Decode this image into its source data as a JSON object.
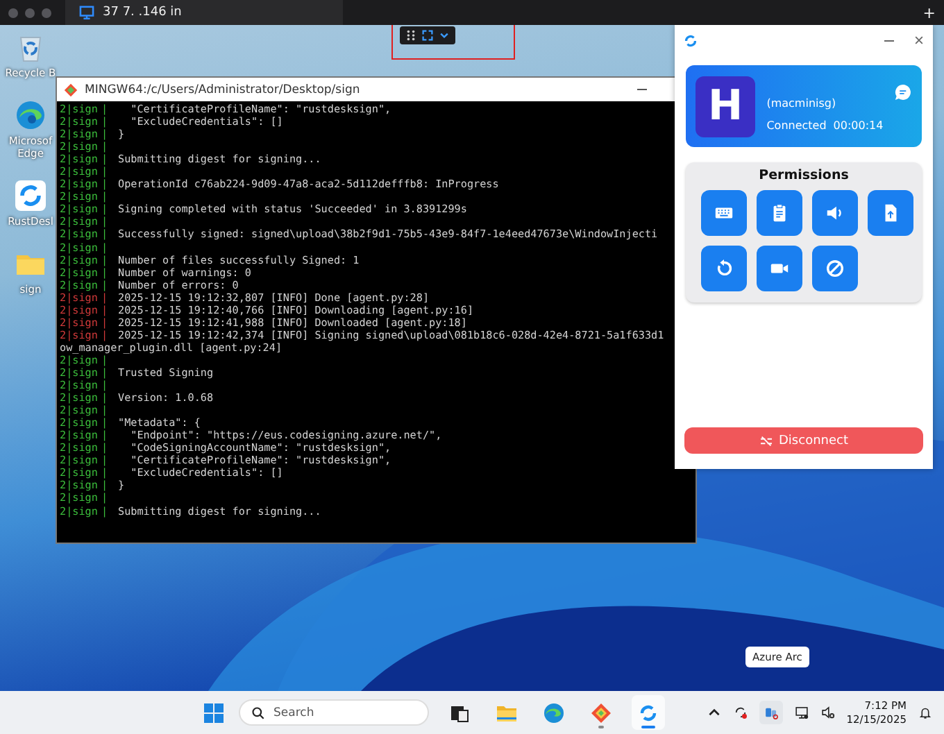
{
  "top_bar": {
    "tab_title": "37 7. .146 in",
    "new_tab": "+"
  },
  "desktop_icons": [
    {
      "kind": "recycle",
      "label": "Recycle B"
    },
    {
      "kind": "edge",
      "label": "Microsof Edge"
    },
    {
      "kind": "rustdesk",
      "label": "RustDesl"
    },
    {
      "kind": "folder",
      "label": "sign"
    }
  ],
  "terminal": {
    "title": "MINGW64:/c/Users/Administrator/Desktop/sign",
    "lines": [
      {
        "kind": "log",
        "prefix": "2|sign",
        "sep": "|",
        "text": "  \"CertificateProfileName\": \"rustdesksign\","
      },
      {
        "kind": "log",
        "prefix": "2|sign",
        "sep": "|",
        "text": "  \"ExcludeCredentials\": []"
      },
      {
        "kind": "log",
        "prefix": "2|sign",
        "sep": "|",
        "text": "}"
      },
      {
        "kind": "log",
        "prefix": "2|sign",
        "sep": "|"
      },
      {
        "kind": "log",
        "prefix": "2|sign",
        "sep": "|",
        "text": "Submitting digest for signing..."
      },
      {
        "kind": "log",
        "prefix": "2|sign",
        "sep": "|"
      },
      {
        "kind": "log",
        "prefix": "2|sign",
        "sep": "|",
        "text": "OperationId c76ab224-9d09-47a8-aca2-5d112defffb8: InProgress"
      },
      {
        "kind": "log",
        "prefix": "2|sign",
        "sep": "|"
      },
      {
        "kind": "log",
        "prefix": "2|sign",
        "sep": "|",
        "text": "Signing completed with status 'Succeeded' in 3.8391299s"
      },
      {
        "kind": "log",
        "prefix": "2|sign",
        "sep": "|"
      },
      {
        "kind": "log",
        "prefix": "2|sign",
        "sep": "|",
        "text": "Successfully signed: signed\\upload\\38b2f9d1-75b5-43e9-84f7-1e4eed47673e\\WindowInjecti"
      },
      {
        "kind": "log",
        "prefix": "2|sign",
        "sep": "|"
      },
      {
        "kind": "log",
        "prefix": "2|sign",
        "sep": "|",
        "text": "Number of files successfully Signed: 1"
      },
      {
        "kind": "log",
        "prefix": "2|sign",
        "sep": "|",
        "text": "Number of warnings: 0"
      },
      {
        "kind": "log",
        "prefix": "2|sign",
        "sep": "|",
        "text": "Number of errors: 0"
      },
      {
        "kind": "error",
        "prefix": "2|sign",
        "sep": "|",
        "text": "2025-12-15 19:12:32,807 [INFO] Done [agent.py:28]"
      },
      {
        "kind": "error",
        "prefix": "2|sign",
        "sep": "|",
        "text": "2025-12-15 19:12:40,766 [INFO] Downloading [agent.py:16]"
      },
      {
        "kind": "error",
        "prefix": "2|sign",
        "sep": "|",
        "text": "2025-12-15 19:12:41,988 [INFO] Downloaded [agent.py:18]"
      },
      {
        "kind": "error",
        "prefix": "2|sign",
        "sep": "|",
        "text": "2025-12-15 19:12:42,374 [INFO] Signing signed\\upload\\081b18c6-028d-42e4-8721-5a1f633d1"
      },
      {
        "kind": "wrap",
        "text": "ow_manager_plugin.dll [agent.py:24]"
      },
      {
        "kind": "log",
        "prefix": "2|sign",
        "sep": "|"
      },
      {
        "kind": "log",
        "prefix": "2|sign",
        "sep": "|",
        "text": "Trusted Signing"
      },
      {
        "kind": "log",
        "prefix": "2|sign",
        "sep": "|"
      },
      {
        "kind": "log",
        "prefix": "2|sign",
        "sep": "|",
        "text": "Version: 1.0.68"
      },
      {
        "kind": "log",
        "prefix": "2|sign",
        "sep": "|"
      },
      {
        "kind": "log",
        "prefix": "2|sign",
        "sep": "|",
        "text": "\"Metadata\": {"
      },
      {
        "kind": "log",
        "prefix": "2|sign",
        "sep": "|",
        "text": "  \"Endpoint\": \"https://eus.codesigning.azure.net/\","
      },
      {
        "kind": "log",
        "prefix": "2|sign",
        "sep": "|",
        "text": "  \"CodeSigningAccountName\": \"rustdesksign\","
      },
      {
        "kind": "log",
        "prefix": "2|sign",
        "sep": "|",
        "text": "  \"CertificateProfileName\": \"rustdesksign\","
      },
      {
        "kind": "log",
        "prefix": "2|sign",
        "sep": "|",
        "text": "  \"ExcludeCredentials\": []"
      },
      {
        "kind": "log",
        "prefix": "2|sign",
        "sep": "|",
        "text": "}"
      },
      {
        "kind": "log",
        "prefix": "2|sign",
        "sep": "|"
      },
      {
        "kind": "log",
        "prefix": "2|sign",
        "sep": "|",
        "text": "Submitting digest for signing..."
      }
    ]
  },
  "connection_panel": {
    "avatar_letter": "H",
    "device": "(macminisg)",
    "status": "Connected",
    "elapsed": "00:00:14",
    "permissions_title": "Permissions",
    "permissions": [
      {
        "kind": "keyboard"
      },
      {
        "kind": "clipboard"
      },
      {
        "kind": "audio"
      },
      {
        "kind": "file"
      },
      {
        "kind": "restart"
      },
      {
        "kind": "camera"
      },
      {
        "kind": "block"
      }
    ],
    "disconnect": "Disconnect"
  },
  "tooltip": "Azure Arc",
  "taskbar": {
    "search_placeholder": "Search",
    "apps": [
      {
        "kind": "taskview",
        "running": false,
        "selected": false
      },
      {
        "kind": "folder",
        "running": false,
        "selected": false
      },
      {
        "kind": "edge",
        "running": false,
        "selected": false
      },
      {
        "kind": "git",
        "running": true,
        "selected": false
      },
      {
        "kind": "rustdesk",
        "running": true,
        "selected": true
      }
    ],
    "time": "7:12 PM",
    "date": "12/15/2025"
  }
}
